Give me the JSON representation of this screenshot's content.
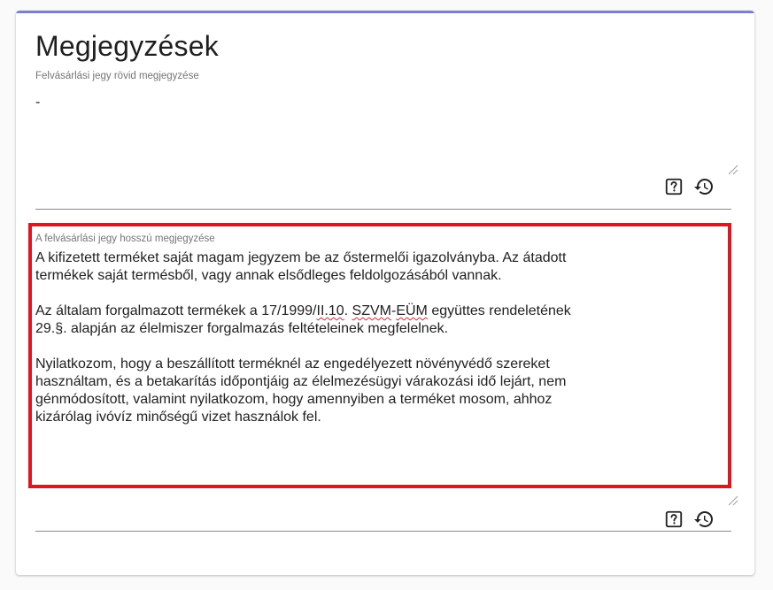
{
  "card": {
    "title": "Megjegyzések"
  },
  "short_note": {
    "label": "Felvásárlási jegy rövid megjegyzése",
    "value": "-",
    "help_icon": "help-box-icon",
    "reset_icon": "restore-icon"
  },
  "long_note": {
    "label": "A felvásárlási jegy hosszú megjegyzése",
    "paragraphs": [
      {
        "line1": "A kifizetett terméket saját magam jegyzem be az őstermelői igazolványba. Az átadott",
        "line2": "termékek saját termésből, vagy annak elsődleges feldolgozásából vannak."
      },
      {
        "line1_a": "Az általam forgalmazott termékek a 17/1999/",
        "line1_b": "II.10",
        "line1_c": ". ",
        "line1_d": "SZVM",
        "line1_e": "-",
        "line1_f": "EÜM",
        "line1_g": " együttes rendeletének",
        "line2": "29.§. alapján az élelmiszer forgalmazás feltételeinek megfelelnek."
      },
      {
        "line1": "Nyilatkozom, hogy a beszállított terméknél az engedélyezett növényvédő szereket",
        "line2": "használtam, és a betakarítás időpontjáig az élelmezésügyi várakozási idő lejárt, nem",
        "line3": "génmódosított, valamint nyilatkozom, hogy amennyiben a terméket mosom, ahhoz",
        "line4": "kizárólag ivóvíz minőségű vizet használok fel."
      }
    ],
    "help_icon": "help-box-icon",
    "reset_icon": "restore-icon"
  },
  "colors": {
    "accent_top": "#7b7fd1",
    "highlight": "#e0161e",
    "label": "#757575",
    "text": "#212121"
  }
}
